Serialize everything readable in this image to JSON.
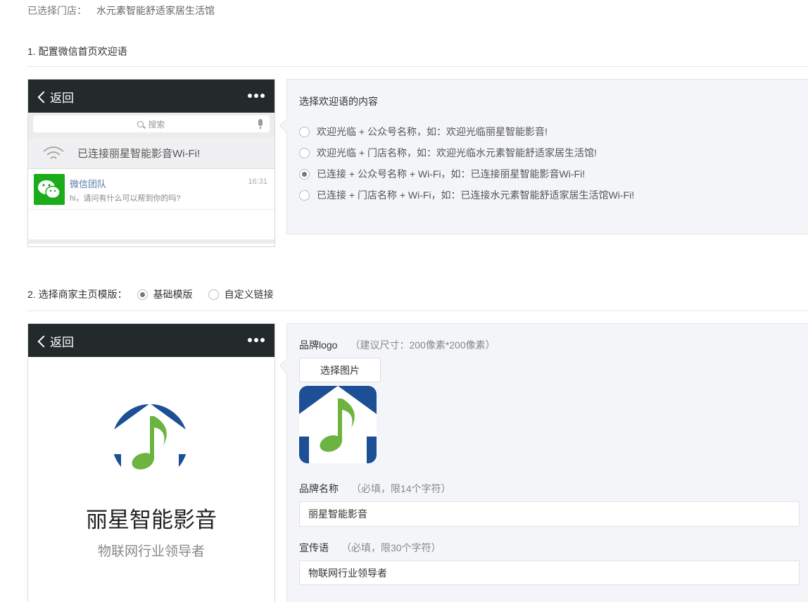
{
  "store": {
    "label": "已选择门店：",
    "value": "水元素智能舒适家居生活馆"
  },
  "section1": {
    "title": "1. 配置微信首页欢迎语"
  },
  "phone1": {
    "back": "返回",
    "search": "搜索",
    "wifi_text": "已连接丽星智能影音Wi-Fi!",
    "chat_name": "微信团队",
    "chat_msg": "hi，请问有什么可以帮到你的吗?",
    "chat_time": "16:31"
  },
  "welcome_panel": {
    "title": "选择欢迎语的内容",
    "options": [
      "欢迎光临 + 公众号名称，如：欢迎光临丽星智能影音!",
      "欢迎光临 + 门店名称，如：欢迎光临水元素智能舒适家居生活馆!",
      "已连接 + 公众号名称 + Wi-Fi，如：已连接丽星智能影音Wi-Fi!",
      "已连接 + 门店名称 + Wi-Fi，如：已连接水元素智能舒适家居生活馆Wi-Fi!"
    ],
    "selected_index": 2
  },
  "section2": {
    "title": "2. 选择商家主页模版：",
    "opt_basic": "基础模版",
    "opt_custom": "自定义链接",
    "selected": "basic"
  },
  "phone2": {
    "back": "返回",
    "brand_name": "丽星智能影音",
    "slogan": "物联网行业领导者"
  },
  "brand_panel": {
    "logo_label": "品牌logo",
    "logo_hint": "（建议尺寸：200像素*200像素）",
    "choose_image": "选择图片",
    "name_label": "品牌名称",
    "name_hint": "（必填，限14个字符）",
    "name_value": "丽星智能影音",
    "slogan_label": "宣传语",
    "slogan_hint": "（必填，限30个字符）",
    "slogan_value": "物联网行业领导者"
  },
  "colors": {
    "phone_bar": "#24292c",
    "wechat_green": "#1aad19",
    "logo_blue": "#1c4f96",
    "logo_green": "#6cb33f",
    "panel_bg": "#f4f5f9"
  }
}
